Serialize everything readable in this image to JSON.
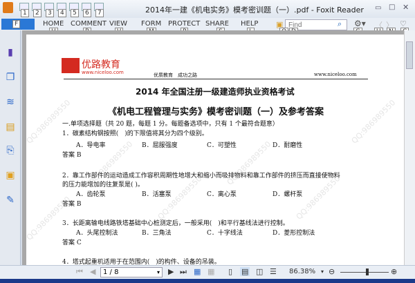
{
  "window": {
    "title": "2014年一建《机电实务》模考密训题（一）.pdf - Foxit Reader"
  },
  "quick_access_keys": [
    "1",
    "2",
    "3",
    "4",
    "5",
    "6",
    "7"
  ],
  "ribbon": {
    "file_key": "F",
    "tabs": [
      {
        "label": "HOME",
        "key": "H"
      },
      {
        "label": "COMMENT",
        "key": "R"
      },
      {
        "label": "VIEW",
        "key": "V"
      },
      {
        "label": "FORM",
        "key": "M"
      },
      {
        "label": "PROTECT",
        "key": "P"
      },
      {
        "label": "SHARE",
        "key": "S"
      },
      {
        "label": "HELP",
        "key": "L"
      }
    ],
    "find_placeholder": "Find",
    "extra_keys": [
      "Q",
      "D",
      "G",
      "U",
      "N",
      "C"
    ]
  },
  "document": {
    "logo_text": "优路教育",
    "logo_url": "www.niceloo.com",
    "header_slogan": "优质教育　成功之路",
    "header_url": "www.niceloo.com",
    "title1": "2014 年全国注册一级建造师执业资格考试",
    "title2": "《机电工程管理与实务》模考密训题（一）及参考答案",
    "section": "一.单项选择题（共 20 题，每题 1 分。每题备选项中，只有 1 个最符合题意）",
    "questions": [
      {
        "text": "1．碳素结构钢按照(　)的下限值将其分为四个级别。",
        "options": [
          "A．导电率",
          "B．屈服强度",
          "C．可塑性",
          "D．耐磨性"
        ],
        "answer": "答案 B"
      },
      {
        "text": "2．靠工作部件的运动造成工作容积周期性地增大和缩小而吸排物料和靠工作部件的挤压而直接使物料",
        "text2": "的压力能增加的往复泵是( )。",
        "options": [
          "A．齿轮泵",
          "B．活塞泵",
          "C．离心泵",
          "D．螺杆泵"
        ],
        "answer": "答案 B"
      },
      {
        "text": "3．长距离输电线路铁塔基础中心桩测定后，一般采用(　)和平行基线法进行控制。",
        "options": [
          "A．头尾控制法",
          "B．三角法",
          "C．十字线法",
          "D．菱形控制法"
        ],
        "answer": "答案 C"
      },
      {
        "text": "4．塔式起重机适用于在范围内(　)的构件、设备的吊装。"
      }
    ],
    "watermark": "QQ:986989550"
  },
  "statusbar": {
    "page": "1 / 8",
    "zoom": "86.38%",
    "zoom_fraction": 0.55
  }
}
